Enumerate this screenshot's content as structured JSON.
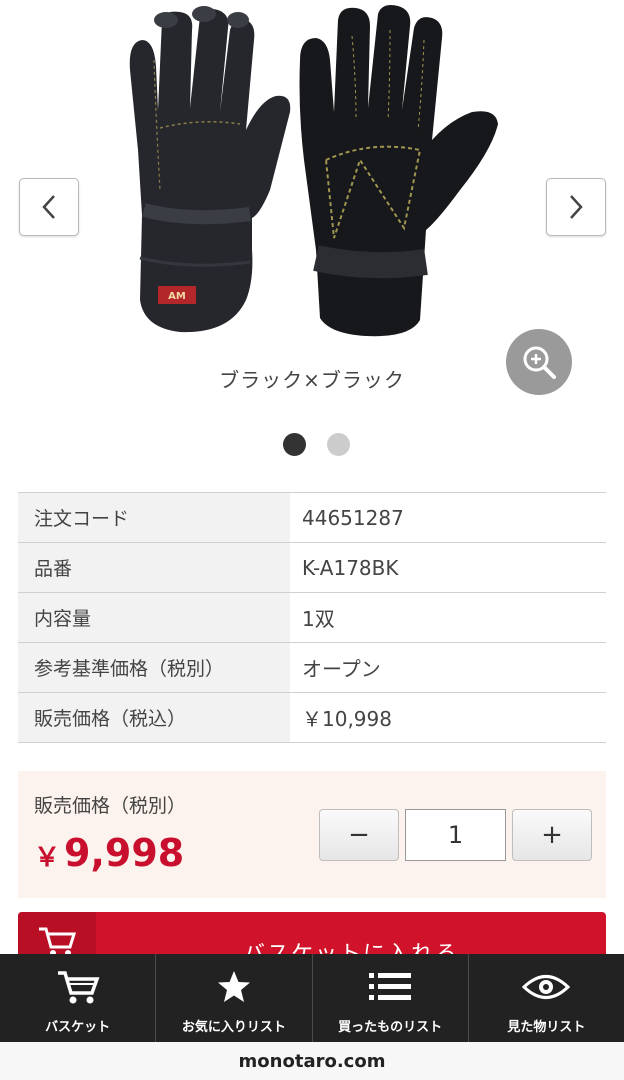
{
  "gallery": {
    "image_alt": "product-gloves-image",
    "caption": "ブラック×ブラック",
    "prev_icon": "chevron-left-icon",
    "next_icon": "chevron-right-icon",
    "zoom_icon": "zoom-in-icon",
    "dots": [
      {
        "state": "active"
      },
      {
        "state": "inactive"
      }
    ]
  },
  "specs": [
    {
      "label": "注文コード",
      "value": "44651287"
    },
    {
      "label": "品番",
      "value": "K-A178BK"
    },
    {
      "label": "内容量",
      "value": "1双"
    },
    {
      "label": "参考基準価格（税別）",
      "value": "オープン"
    },
    {
      "label": "販売価格（税込）",
      "value": "￥10,998"
    }
  ],
  "price": {
    "label": "販売価格（税別）",
    "currency": "￥",
    "amount": "9,998",
    "color": "#c8102e"
  },
  "quantity": {
    "minus_label": "−",
    "value": "1",
    "plus_label": "+"
  },
  "cart_button": {
    "label": "バスケットに入れる",
    "icon": "cart-icon",
    "color": "#d0132b"
  },
  "bottom_nav": {
    "items": [
      {
        "label": "バスケット",
        "icon": "cart-icon"
      },
      {
        "label": "お気に入りリスト",
        "icon": "star-icon"
      },
      {
        "label": "買ったものリスト",
        "icon": "list-icon"
      },
      {
        "label": "見た物リスト",
        "icon": "eye-icon"
      }
    ]
  },
  "url_bar": {
    "domain": "monotaro.com"
  }
}
